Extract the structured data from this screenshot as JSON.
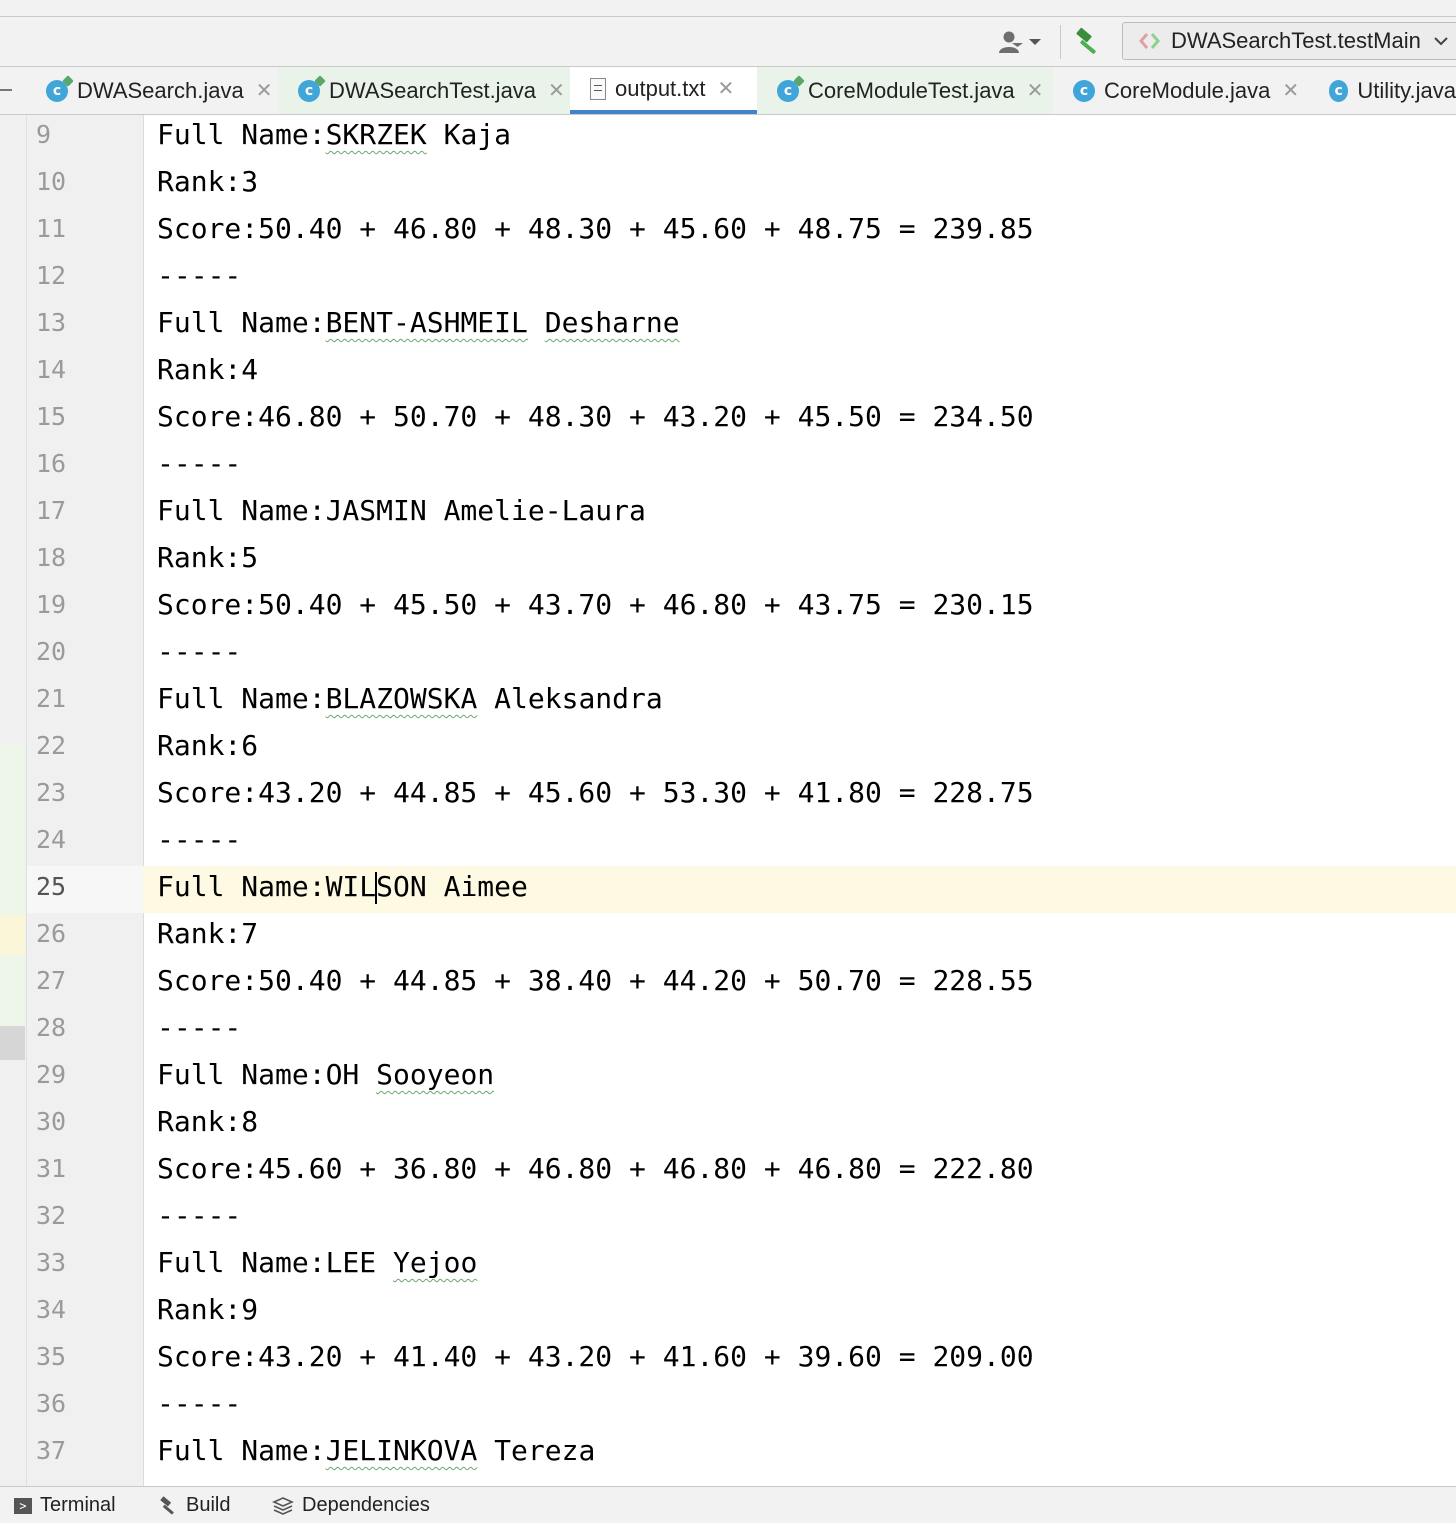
{
  "toolbar": {
    "user_icon": "user-dropdown-icon",
    "build_icon": "hammer-icon",
    "run_config": "DWASearchTest.testMain"
  },
  "tabs": [
    {
      "label": "DWASearch.java",
      "type": "java",
      "active": false
    },
    {
      "label": "DWASearchTest.java",
      "type": "java-test",
      "active": false
    },
    {
      "label": "output.txt",
      "type": "text",
      "active": true
    },
    {
      "label": "CoreModuleTest.java",
      "type": "java-test",
      "active": false
    },
    {
      "label": "CoreModule.java",
      "type": "java",
      "active": false
    },
    {
      "label": "Utility.java",
      "type": "java",
      "active": false
    }
  ],
  "editor": {
    "lines": [
      {
        "n": "9",
        "text": "Full Name:SKRZEK Kaja"
      },
      {
        "n": "10",
        "text": "Rank:3"
      },
      {
        "n": "11",
        "text": "Score:50.40 + 46.80 + 48.30 + 45.60 + 48.75 = 239.85"
      },
      {
        "n": "12",
        "text": "-----"
      },
      {
        "n": "13",
        "text": "Full Name:BENT-ASHMEIL Desharne"
      },
      {
        "n": "14",
        "text": "Rank:4"
      },
      {
        "n": "15",
        "text": "Score:46.80 + 50.70 + 48.30 + 43.20 + 45.50 = 234.50"
      },
      {
        "n": "16",
        "text": "-----"
      },
      {
        "n": "17",
        "text": "Full Name:JASMIN Amelie-Laura"
      },
      {
        "n": "18",
        "text": "Rank:5"
      },
      {
        "n": "19",
        "text": "Score:50.40 + 45.50 + 43.70 + 46.80 + 43.75 = 230.15"
      },
      {
        "n": "20",
        "text": "-----"
      },
      {
        "n": "21",
        "text": "Full Name:BLAZOWSKA Aleksandra"
      },
      {
        "n": "22",
        "text": "Rank:6"
      },
      {
        "n": "23",
        "text": "Score:43.20 + 44.85 + 45.60 + 53.30 + 41.80 = 228.75"
      },
      {
        "n": "24",
        "text": "-----"
      },
      {
        "n": "25",
        "text": "Full Name:WILSON Aimee"
      },
      {
        "n": "26",
        "text": "Rank:7"
      },
      {
        "n": "27",
        "text": "Score:50.40 + 44.85 + 38.40 + 44.20 + 50.70 = 228.55"
      },
      {
        "n": "28",
        "text": "-----"
      },
      {
        "n": "29",
        "text": "Full Name:OH Sooyeon"
      },
      {
        "n": "30",
        "text": "Rank:8"
      },
      {
        "n": "31",
        "text": "Score:45.60 + 36.80 + 46.80 + 46.80 + 46.80 = 222.80"
      },
      {
        "n": "32",
        "text": "-----"
      },
      {
        "n": "33",
        "text": "Full Name:LEE Yejoo"
      },
      {
        "n": "34",
        "text": "Rank:9"
      },
      {
        "n": "35",
        "text": "Score:43.20 + 41.40 + 43.20 + 41.60 + 39.60 = 209.00"
      },
      {
        "n": "36",
        "text": "-----"
      },
      {
        "n": "37",
        "text": "Full Name:JELINKOVA Tereza"
      }
    ],
    "caret": {
      "line": "25",
      "after_text": "Full Name:WIL",
      "rest_text": "SON Aimee"
    }
  },
  "bottom_tools": [
    {
      "label": "Terminal",
      "icon": "terminal-icon"
    },
    {
      "label": "Build",
      "icon": "hammer-icon"
    },
    {
      "label": "Dependencies",
      "icon": "layers-icon"
    }
  ]
}
